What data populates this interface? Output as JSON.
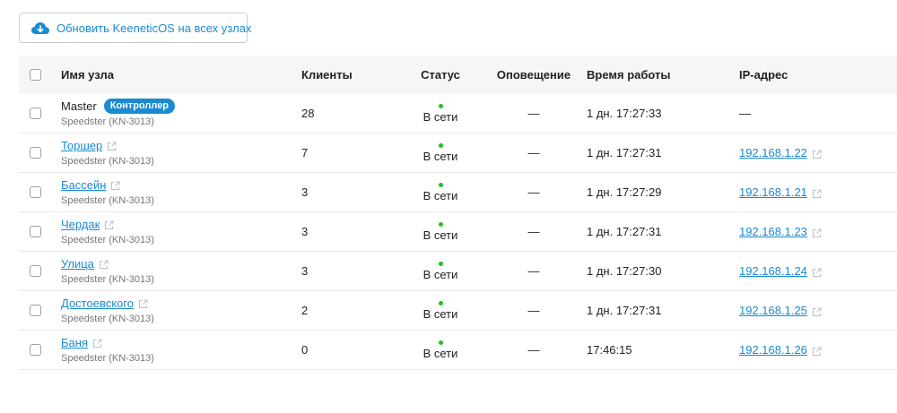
{
  "update_button": {
    "label": "Обновить KeeneticOS на всех узлах",
    "icon": "cloud-download-icon"
  },
  "table": {
    "headers": {
      "name": "Имя узла",
      "clients": "Клиенты",
      "status": "Статус",
      "notify": "Оповещение",
      "uptime": "Время работы",
      "ip": "IP-адрес"
    },
    "rows": [
      {
        "name": "Master",
        "is_link": false,
        "badge": "Контроллер",
        "model": "Speedster (KN-3013)",
        "clients": "28",
        "status": "В сети",
        "notify": "—",
        "uptime": "1 дн. 17:27:33",
        "ip": "—",
        "ip_link": false
      },
      {
        "name": "Торшер",
        "is_link": true,
        "badge": "",
        "model": "Speedster (KN-3013)",
        "clients": "7",
        "status": "В сети",
        "notify": "—",
        "uptime": "1 дн. 17:27:31",
        "ip": "192.168.1.22",
        "ip_link": true
      },
      {
        "name": "Бассейн",
        "is_link": true,
        "badge": "",
        "model": "Speedster (KN-3013)",
        "clients": "3",
        "status": "В сети",
        "notify": "—",
        "uptime": "1 дн. 17:27:29",
        "ip": "192.168.1.21",
        "ip_link": true
      },
      {
        "name": "Чердак",
        "is_link": true,
        "badge": "",
        "model": "Speedster (KN-3013)",
        "clients": "3",
        "status": "В сети",
        "notify": "—",
        "uptime": "1 дн. 17:27:31",
        "ip": "192.168.1.23",
        "ip_link": true
      },
      {
        "name": "Улица",
        "is_link": true,
        "badge": "",
        "model": "Speedster (KN-3013)",
        "clients": "3",
        "status": "В сети",
        "notify": "—",
        "uptime": "1 дн. 17:27:30",
        "ip": "192.168.1.24",
        "ip_link": true
      },
      {
        "name": "Достоевского",
        "is_link": true,
        "badge": "",
        "model": "Speedster (KN-3013)",
        "clients": "2",
        "status": "В сети",
        "notify": "—",
        "uptime": "1 дн. 17:27:31",
        "ip": "192.168.1.25",
        "ip_link": true
      },
      {
        "name": "Баня",
        "is_link": true,
        "badge": "",
        "model": "Speedster (KN-3013)",
        "clients": "0",
        "status": "В сети",
        "notify": "—",
        "uptime": "17:46:15",
        "ip": "192.168.1.26",
        "ip_link": true
      }
    ]
  },
  "colors": {
    "accent": "#1a8ad1",
    "online": "#1fc11f",
    "header_bg": "#f5f6f8"
  }
}
